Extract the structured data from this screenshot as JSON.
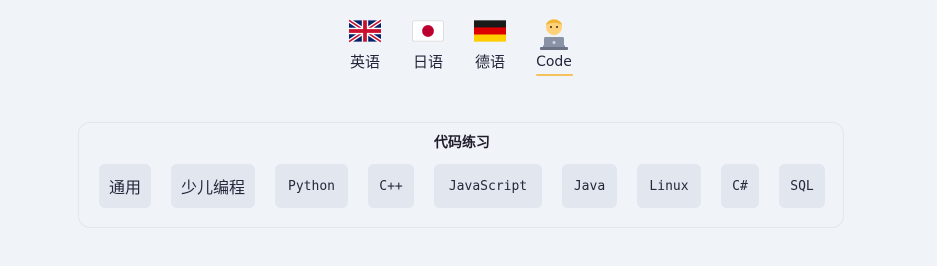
{
  "languages": [
    {
      "label": "英语",
      "icon": "uk-flag-icon"
    },
    {
      "label": "日语",
      "icon": "japan-flag-icon"
    },
    {
      "label": "德语",
      "icon": "germany-flag-icon"
    },
    {
      "label": "Code",
      "icon": "technologist-icon",
      "active": true
    }
  ],
  "panel": {
    "title": "代码练习",
    "categories": [
      "通用",
      "少儿编程",
      "Python",
      "C++",
      "JavaScript",
      "Java",
      "Linux",
      "C#",
      "SQL"
    ]
  },
  "colors": {
    "background": "#f0f3f8",
    "chip_background": "#e1e6ef",
    "active_underline": "#f4c15d"
  }
}
